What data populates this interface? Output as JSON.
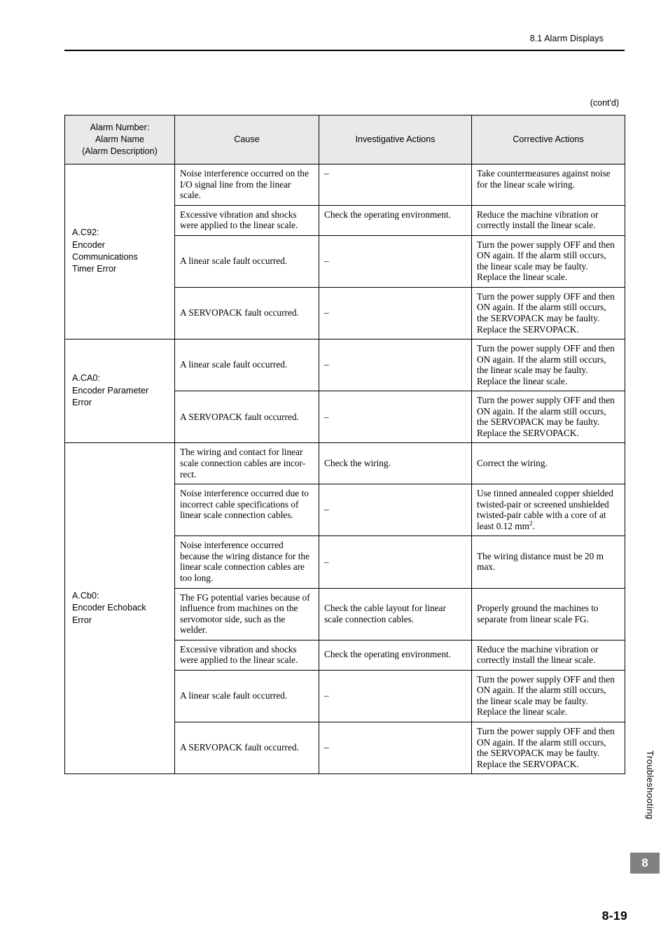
{
  "header": {
    "section": "8.1  Alarm Displays",
    "contd": "(cont'd)"
  },
  "table": {
    "columns": [
      "Alarm Number:\nAlarm Name\n(Alarm Description)",
      "Cause",
      "Investigative Actions",
      "Corrective Actions"
    ],
    "col_alarm_line1": "Alarm Number:",
    "col_alarm_line2": "Alarm Name",
    "col_alarm_line3": "(Alarm Description)",
    "col_cause": "Cause",
    "col_investigative": "Investigative Actions",
    "col_corrective": "Corrective Actions",
    "groups": [
      {
        "alarm": "A.C92:\nEncoder\nCommunications\nTimer Error",
        "rows": [
          {
            "cause": "Noise interference occurred on the I/O signal line from the linear scale.",
            "investigative": "–",
            "corrective": "Take countermeasures against noise for the linear scale wiring."
          },
          {
            "cause": "Excessive vibration and shocks were applied to the linear scale.",
            "investigative": "Check the operating environment.",
            "corrective": "Reduce the machine vibration or correctly install the linear scale."
          },
          {
            "cause": "A linear scale fault occurred.",
            "investigative": "–",
            "corrective": "Turn the power supply OFF and then ON again. If the alarm still occurs, the linear scale may be faulty. Replace the linear scale."
          },
          {
            "cause": "A SERVOPACK fault occurred.",
            "investigative": "–",
            "corrective": "Turn the power supply OFF and then ON again. If the alarm still occurs, the SERVOPACK may be faulty. Replace the SERVOPACK."
          }
        ]
      },
      {
        "alarm": "A.CA0:\nEncoder Parameter\nError",
        "rows": [
          {
            "cause": "A linear scale fault occurred.",
            "investigative": "–",
            "corrective": "Turn the power supply OFF and then ON again. If the alarm still occurs, the linear scale may be faulty. Replace the linear scale."
          },
          {
            "cause": "A SERVOPACK fault occurred.",
            "investigative": "–",
            "corrective": "Turn the power supply OFF and then ON again. If the alarm still occurs, the SERVOPACK may be faulty. Replace the SERVOPACK."
          }
        ]
      },
      {
        "alarm": "A.Cb0:\nEncoder Echoback\nError",
        "rows": [
          {
            "cause": "The wiring and contact for linear scale connection cables are incor-rect.",
            "investigative": "Check the wiring.",
            "corrective": "Correct the wiring."
          },
          {
            "cause": "Noise interference occurred due to incorrect cable specifications of linear scale connection cables.",
            "investigative": "–",
            "corrective_pre": "Use tinned annealed copper shielded twisted-pair or screened unshielded twisted-pair cable with a core of at least 0.12 mm",
            "corrective_sup": "2",
            "corrective_post": "."
          },
          {
            "cause": "Noise interference occurred because the wiring distance for the linear scale connection cables are too long.",
            "investigative": "–",
            "corrective": "The wiring distance must be 20 m max."
          },
          {
            "cause": "The FG potential varies because of influence from machines on the servomotor side, such as the welder.",
            "investigative": "Check the cable layout for linear scale connection cables.",
            "corrective": "Properly ground the machines to separate from linear scale FG."
          },
          {
            "cause": "Excessive vibration and shocks were applied to the linear scale.",
            "investigative": "Check the operating environment.",
            "corrective": "Reduce the machine vibration or correctly install the linear scale."
          },
          {
            "cause": "A linear scale fault occurred.",
            "investigative": "–",
            "corrective": "Turn the power supply OFF and then ON again. If the alarm still occurs, the linear scale may be faulty. Replace the linear scale."
          },
          {
            "cause": "A SERVOPACK fault occurred.",
            "investigative": "–",
            "corrective": "Turn the power supply OFF and then ON again. If the alarm still occurs, the SERVOPACK may be faulty. Replace the SERVOPACK."
          }
        ]
      }
    ]
  },
  "footer": {
    "side_tab": "Troubleshooting",
    "chapter": "8",
    "page_number": "8-19"
  }
}
